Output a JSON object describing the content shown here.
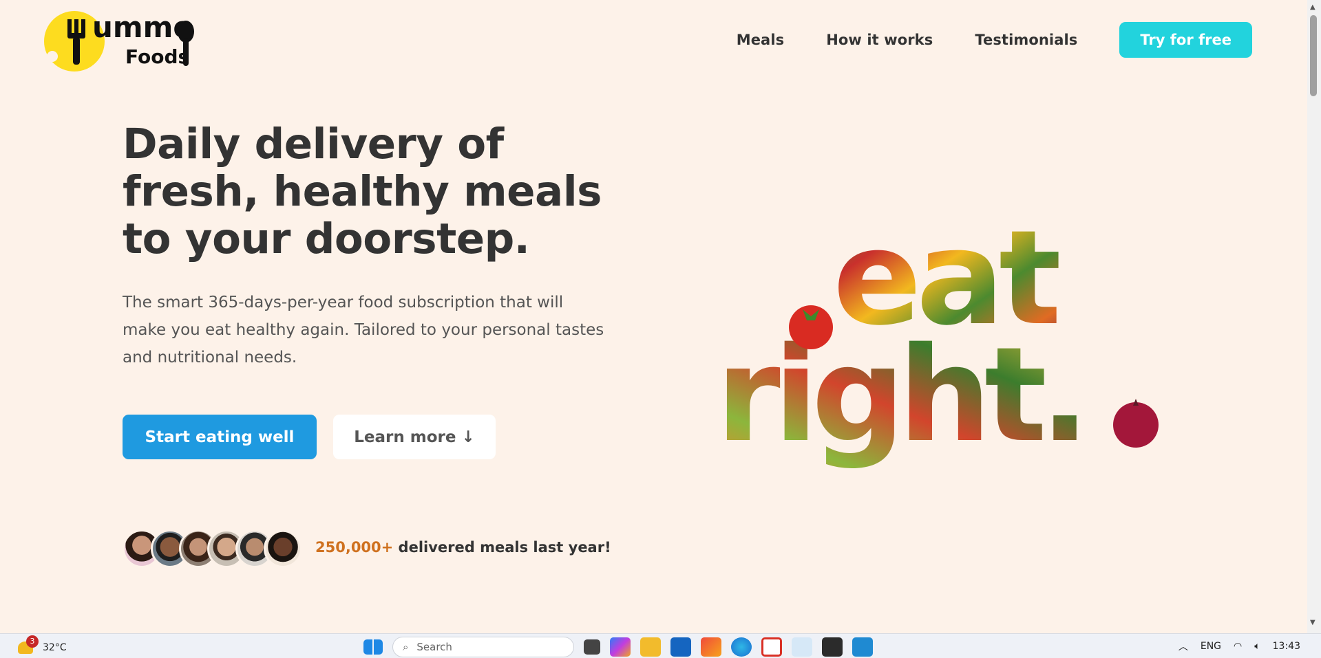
{
  "brand": {
    "logo_line1": "ummo",
    "logo_line2": "Foods",
    "colors": {
      "accent": "#22d3dd",
      "primary": "#1f9ae0",
      "highlight": "#cf711f",
      "logo_yellow": "#fddc1f",
      "background": "#fdf2e9"
    }
  },
  "nav": {
    "links": [
      "Meals",
      "How it works",
      "Testimonials"
    ],
    "cta": "Try for free"
  },
  "hero": {
    "title": "Daily delivery of fresh, healthy meals to your doorstep.",
    "description": "The smart 365-days-per-year food subscription that will make you eat healthy again. Tailored to your personal tastes and nutritional needs.",
    "primary_button": "Start eating well",
    "secondary_button": "Learn more ↓",
    "art_text": [
      "eat",
      "right."
    ],
    "stat_number": "250,000+",
    "stat_text": " delivered meals last year!",
    "avatar_count": 6
  },
  "taskbar": {
    "weather_badge": "3",
    "temperature": "32°C",
    "search_placeholder": "Search",
    "language": "ENG",
    "clock": "13:43",
    "icons": [
      "windows-start-icon",
      "search-icon",
      "task-view-icon",
      "copilot-icon",
      "file-explorer-icon",
      "store-icon",
      "office-icon",
      "edge-icon",
      "gmail-icon",
      "browser-icon",
      "terminal-icon",
      "vscode-icon"
    ]
  }
}
